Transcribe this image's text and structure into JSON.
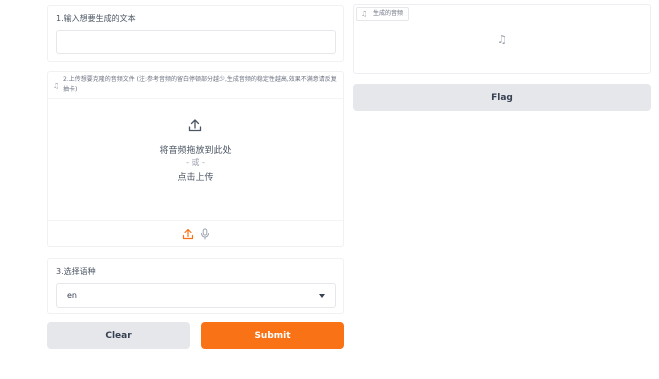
{
  "text_block": {
    "label": "1.输入想要生成的文本",
    "value": ""
  },
  "audio_block": {
    "label": "2.上传想要克隆的音频文件 (注:参考音频的留白停顿部分越少,生成音频的稳定性越高,效果不满意请反复抽卡)",
    "drop_text": "将音频拖放到此处",
    "or_text": "- 或 -",
    "click_text": "点击上传",
    "label_icon": "music-note-icon",
    "tools": [
      "upload-icon",
      "microphone-icon"
    ]
  },
  "lang_block": {
    "label": "3.选择语种",
    "selected": "en"
  },
  "buttons": {
    "clear": "Clear",
    "submit": "Submit",
    "flag": "Flag"
  },
  "output": {
    "label": "生成的音频",
    "label_icon": "music-note-icon",
    "placeholder_icon": "music-note-icon"
  },
  "colors": {
    "accent": "#f97316",
    "secondary_button": "#e5e7eb",
    "border": "#e5e7eb"
  }
}
